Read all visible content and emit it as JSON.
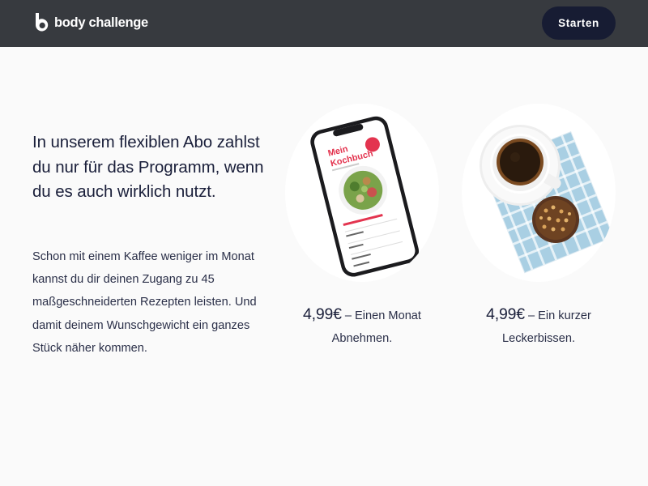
{
  "header": {
    "logo_text": "body challenge",
    "start_button": "Starten"
  },
  "main": {
    "headline": "In unserem flexiblen Abo zahlst du nur für das Programm, wenn du es auch wirklich nutzt.",
    "body": "Schon mit einem Kaffee weniger im Monat kannst du dir deinen Zugang zu 45 maßgeschneiderten Rezepten leisten. Und damit deinem Wunschgewicht ein ganzes Stück näher kommen."
  },
  "offers": [
    {
      "image": "phone-cookbook-image",
      "phone_title": "Mein Kochbuch",
      "price": "4,99€",
      "desc": " – Einen Monat Abnehmen."
    },
    {
      "image": "coffee-cookie-image",
      "price": "4,99€",
      "desc": " – Ein kurzer Leckerbissen."
    }
  ],
  "colors": {
    "header_bg": "#373a3f",
    "button_bg": "#171c33",
    "text_dark": "#1a1f3a",
    "accent_red": "#e3344f",
    "page_bg": "#fafafa"
  }
}
